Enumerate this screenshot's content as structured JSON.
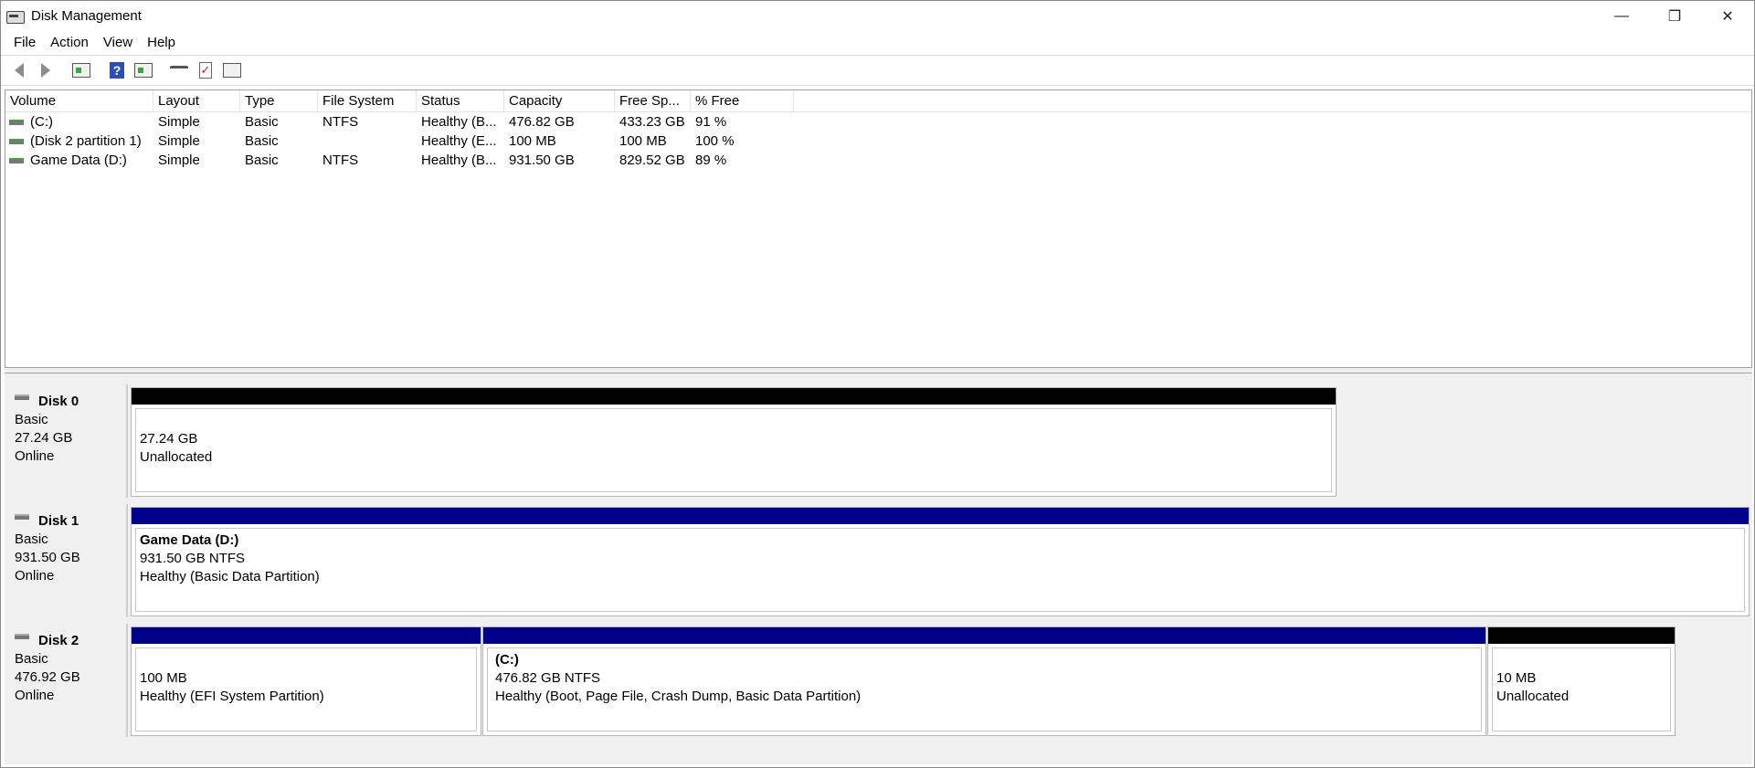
{
  "window": {
    "title": "Disk Management",
    "controls": {
      "minimize": "—",
      "restore": "❐",
      "close": "✕"
    }
  },
  "menu": [
    "File",
    "Action",
    "View",
    "Help"
  ],
  "toolbar": {
    "icons": [
      "back-arrow-icon",
      "forward-arrow-icon",
      "console-tree-icon",
      "help-icon",
      "properties-icon",
      "connect-icon",
      "checklist-icon",
      "settings-list-icon"
    ]
  },
  "volume_list": {
    "columns": [
      "Volume",
      "Layout",
      "Type",
      "File System",
      "Status",
      "Capacity",
      "Free Sp...",
      "% Free"
    ],
    "rows": [
      [
        "(C:)",
        "Simple",
        "Basic",
        "NTFS",
        "Healthy (B...",
        "476.82 GB",
        "433.23 GB",
        "91 %"
      ],
      [
        "(Disk 2 partition 1)",
        "Simple",
        "Basic",
        "",
        "Healthy (E...",
        "100 MB",
        "100 MB",
        "100 %"
      ],
      [
        "Game Data (D:)",
        "Simple",
        "Basic",
        "NTFS",
        "Healthy (B...",
        "931.50 GB",
        "829.52 GB",
        "89 %"
      ]
    ]
  },
  "disks": [
    {
      "name": "Disk 0",
      "type": "Basic",
      "size": "27.24 GB",
      "status": "Online",
      "partitions": [
        {
          "label": "",
          "size": "27.24 GB",
          "detail": "Unallocated",
          "bar": "black"
        }
      ]
    },
    {
      "name": "Disk 1",
      "type": "Basic",
      "size": "931.50 GB",
      "status": "Online",
      "partitions": [
        {
          "label": "Game Data  (D:)",
          "size": "931.50 GB NTFS",
          "detail": "Healthy (Basic Data Partition)",
          "bar": "blue"
        }
      ]
    },
    {
      "name": "Disk 2",
      "type": "Basic",
      "size": "476.92 GB",
      "status": "Online",
      "partitions": [
        {
          "label": "",
          "size": "100 MB",
          "detail": "Healthy (EFI System Partition)",
          "bar": "blue"
        },
        {
          "label": "(C:)",
          "size": "476.82 GB NTFS",
          "detail": "Healthy (Boot, Page File, Crash Dump, Basic Data Partition)",
          "bar": "blue"
        },
        {
          "label": "",
          "size": "10 MB",
          "detail": "Unallocated",
          "bar": "black"
        }
      ]
    }
  ],
  "colors": {
    "unallocated": "#000000",
    "primary_partition": "#00008b",
    "pane_background": "#f0f0f0"
  }
}
